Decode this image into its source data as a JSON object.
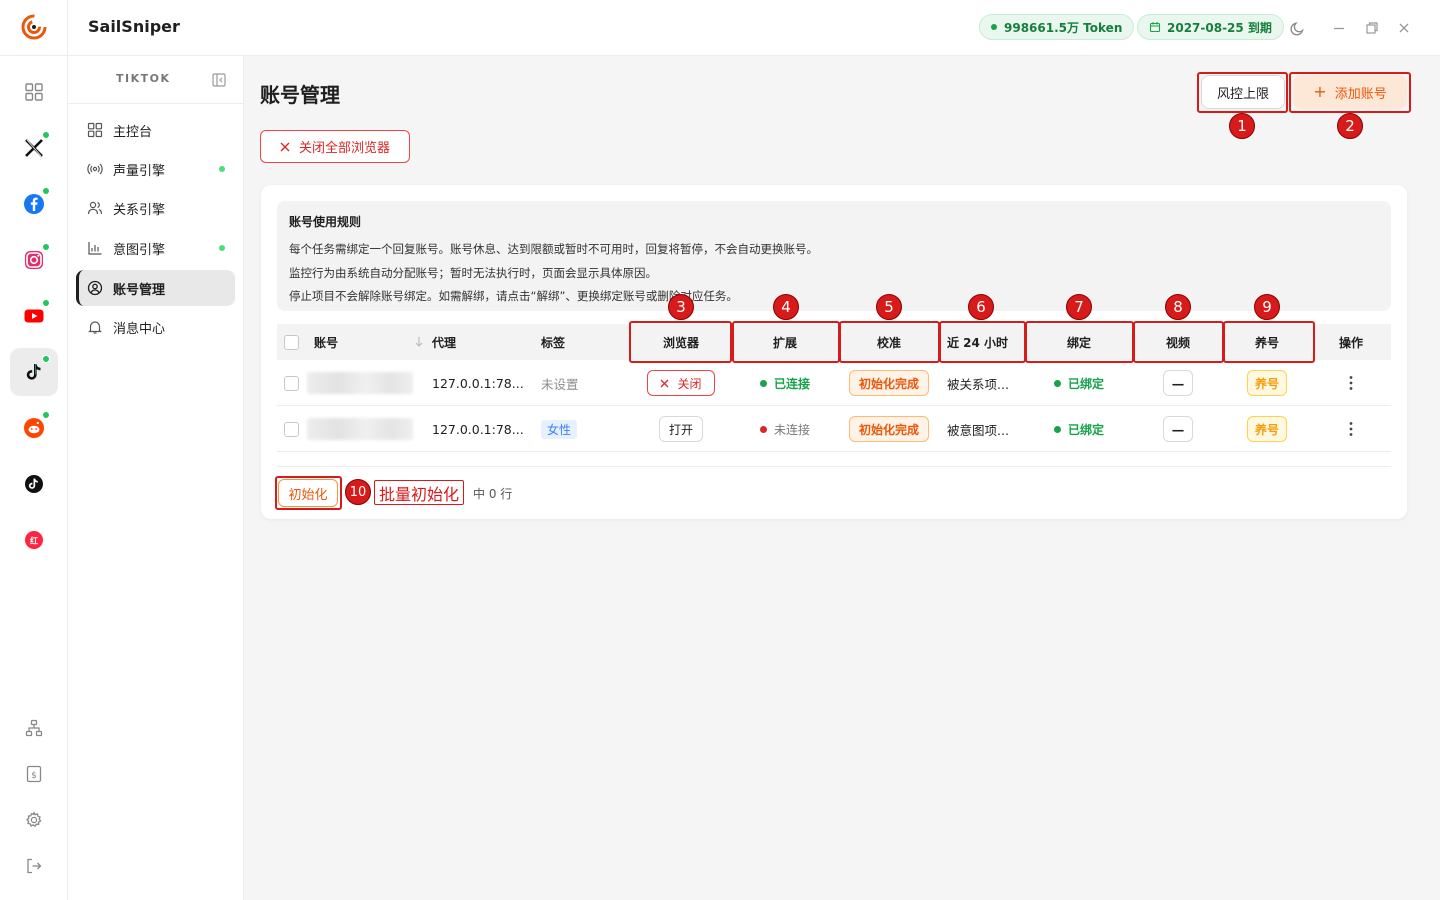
{
  "app": {
    "brand": "SailSniper"
  },
  "topbar": {
    "token_label": "998661.5万 Token",
    "expiry_label": "2027-08-25 到期"
  },
  "rail": {
    "items": [
      {
        "name": "dashboard-grid",
        "status": false
      },
      {
        "name": "x-twitter",
        "status": true
      },
      {
        "name": "facebook",
        "status": true
      },
      {
        "name": "instagram",
        "status": true
      },
      {
        "name": "youtube",
        "status": true
      },
      {
        "name": "tiktok",
        "status": true,
        "active": true
      },
      {
        "name": "reddit",
        "status": true
      },
      {
        "name": "tiktok-alt",
        "status": false
      },
      {
        "name": "xiaohongshu",
        "status": false
      }
    ]
  },
  "sidebar": {
    "section_title": "TIKTOK",
    "items": [
      {
        "label": "主控台",
        "icon": "grid-icon",
        "dot": false
      },
      {
        "label": "声量引擎",
        "icon": "broadcast-icon",
        "dot": true
      },
      {
        "label": "关系引擎",
        "icon": "users-icon",
        "dot": false
      },
      {
        "label": "意图引擎",
        "icon": "bar-chart-icon",
        "dot": true
      },
      {
        "label": "账号管理",
        "icon": "user-circle-icon",
        "dot": false,
        "active": true
      },
      {
        "label": "消息中心",
        "icon": "bell-icon",
        "dot": false
      }
    ]
  },
  "main": {
    "title": "账号管理",
    "risk_limit_label": "风控上限",
    "add_account_label": "添加账号",
    "close_all_label": "关闭全部浏览器",
    "rules": {
      "title": "账号使用规则",
      "lines": [
        "每个任务需绑定一个回复账号。账号休息、达到限额或暂时不可用时，回复将暂停，不会自动更换账号。",
        "监控行为由系统自动分配账号；暂时无法执行时，页面会显示具体原因。",
        "停止项目不会解除账号绑定。如需解绑，请点击“解绑”、更换绑定账号或删除对应任务。"
      ]
    },
    "table": {
      "columns": {
        "account": "账号",
        "proxy": "代理",
        "tag": "标签",
        "browser": "浏览器",
        "extension": "扩展",
        "calibration": "校准",
        "last24h": "近 24 小时",
        "binding": "绑定",
        "video": "视频",
        "nurture": "养号",
        "actions": "操作"
      },
      "rows": [
        {
          "proxy": "127.0.0.1:78...",
          "tag": "未设置",
          "browser_btn": "关闭",
          "extension": "已连接",
          "calibration": "初始化完成",
          "last24h": "被关系项...",
          "binding": "已绑定",
          "video": "—",
          "nurture": "养号"
        },
        {
          "proxy": "127.0.0.1:78...",
          "tag": "女性",
          "browser_btn": "打开",
          "extension": "未连接",
          "calibration": "初始化完成",
          "last24h": "被意图项...",
          "binding": "已绑定",
          "video": "—",
          "nurture": "养号"
        }
      ]
    },
    "footer": {
      "init_label": "初始化",
      "selected_count": "中 0 行"
    }
  },
  "annotations": {
    "n1": "1",
    "n2": "2",
    "n3": "3",
    "n4": "4",
    "n5": "5",
    "n6": "6",
    "n7": "7",
    "n8": "8",
    "n9": "9",
    "n10": "10",
    "label10": "批量初始化"
  },
  "colors": {
    "accent": "#ea580c",
    "danger": "#dc2626",
    "success": "#16a34a",
    "annotation": "#d71a1a"
  }
}
